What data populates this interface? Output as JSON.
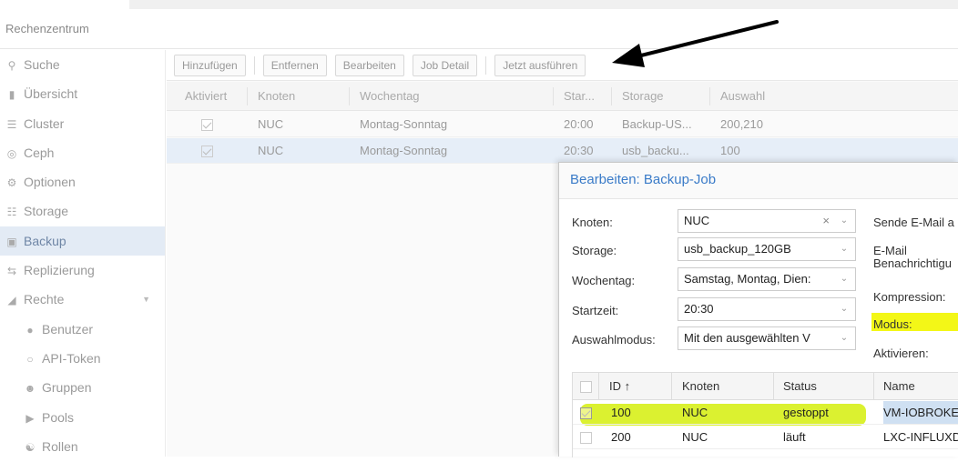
{
  "header": {
    "datacenter": "Rechenzentrum"
  },
  "sidebar": {
    "items": [
      {
        "label": "Suche",
        "icon": "search-icon"
      },
      {
        "label": "Übersicht",
        "icon": "book-icon"
      },
      {
        "label": "Cluster",
        "icon": "server-icon"
      },
      {
        "label": "Ceph",
        "icon": "ceph-icon"
      },
      {
        "label": "Optionen",
        "icon": "gear-icon"
      },
      {
        "label": "Storage",
        "icon": "database-icon"
      },
      {
        "label": "Backup",
        "icon": "floppy-icon"
      },
      {
        "label": "Replizierung",
        "icon": "retweet-icon"
      },
      {
        "label": "Rechte",
        "icon": "unlock-icon"
      },
      {
        "label": "Benutzer",
        "icon": "user-icon"
      },
      {
        "label": "API-Token",
        "icon": "user-outline-icon"
      },
      {
        "label": "Gruppen",
        "icon": "users-icon"
      },
      {
        "label": "Pools",
        "icon": "tags-icon"
      },
      {
        "label": "Rollen",
        "icon": "male-icon"
      }
    ]
  },
  "toolbar": {
    "add": "Hinzufügen",
    "remove": "Entfernen",
    "edit": "Bearbeiten",
    "job_detail": "Job Detail",
    "run_now": "Jetzt ausführen"
  },
  "jobs_grid": {
    "columns": [
      "Aktiviert",
      "Knoten",
      "Wochentag",
      "Star...",
      "Storage",
      "Auswahl"
    ],
    "rows": [
      {
        "enabled": true,
        "node": "NUC",
        "weekday": "Montag-Sonntag",
        "start": "20:00",
        "storage": "Backup-US...",
        "selection": "200,210"
      },
      {
        "enabled": true,
        "node": "NUC",
        "weekday": "Montag-Sonntag",
        "start": "20:30",
        "storage": "usb_backu...",
        "selection": "100"
      }
    ]
  },
  "dialog": {
    "title": "Bearbeiten: Backup-Job",
    "node_label": "Knoten:",
    "node_value": "NUC",
    "storage_label": "Storage:",
    "storage_value": "usb_backup_120GB",
    "weekday_label": "Wochentag:",
    "weekday_value": "Samstag, Montag, Dien:",
    "start_label": "Startzeit:",
    "start_value": "20:30",
    "mode_label": "Auswahlmodus:",
    "mode_value": "Mit den ausgewählten V",
    "send_email_label": "Sende E-Mail a",
    "email_notify_label": "E-Mail",
    "email_notify_label2": "Benachrichtigu",
    "compression_label": "Kompression:",
    "modus_label": "Modus:",
    "activate_label": "Aktivieren:",
    "vm_grid": {
      "columns": [
        "ID ↑",
        "Knoten",
        "Status",
        "Name"
      ],
      "rows": [
        {
          "checked": true,
          "id": "100",
          "node": "NUC",
          "status": "gestoppt",
          "name": "VM-IOBROKEF"
        },
        {
          "checked": false,
          "id": "200",
          "node": "NUC",
          "status": "läuft",
          "name": "LXC-INFLUXDI"
        }
      ]
    }
  },
  "annotation": {
    "highlight_color": "#d7ef1a",
    "arrow_color": "#000000"
  }
}
